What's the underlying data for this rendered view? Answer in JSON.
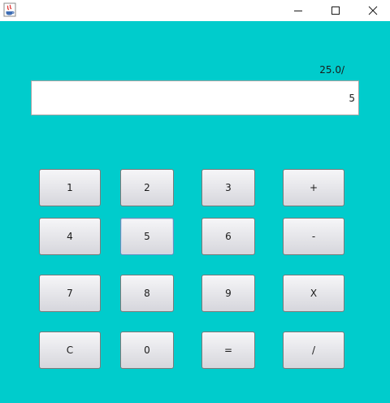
{
  "window": {
    "minimize_glyph": "—",
    "maximize_glyph": "☐",
    "close_glyph": "✕",
    "background_color": "#00cccc"
  },
  "calculator": {
    "previous_expression": "25.0/",
    "display_value": "5",
    "keys": {
      "k1": "1",
      "k2": "2",
      "k3": "3",
      "plus": "+",
      "k4": "4",
      "k5": "5",
      "k6": "6",
      "minus": "-",
      "k7": "7",
      "k8": "8",
      "k9": "9",
      "multiply": "X",
      "clear": "C",
      "k0": "0",
      "equals": "=",
      "divide": "/"
    }
  }
}
